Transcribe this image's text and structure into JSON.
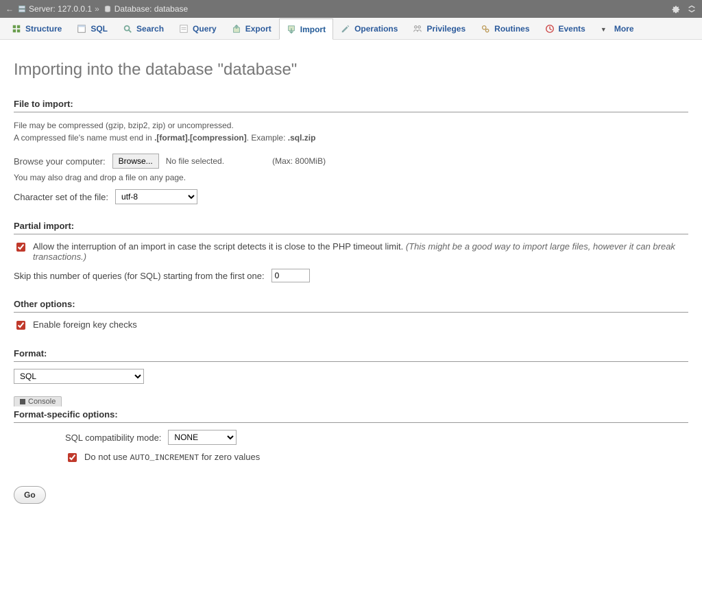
{
  "breadcrumb": {
    "back_arrow": "←",
    "server_label": "Server:",
    "server_value": "127.0.0.1",
    "db_label": "Database:",
    "db_value": "database"
  },
  "tabs": [
    {
      "label": "Structure",
      "icon": "structure"
    },
    {
      "label": "SQL",
      "icon": "sql"
    },
    {
      "label": "Search",
      "icon": "search"
    },
    {
      "label": "Query",
      "icon": "query"
    },
    {
      "label": "Export",
      "icon": "export"
    },
    {
      "label": "Import",
      "icon": "import",
      "active": true
    },
    {
      "label": "Operations",
      "icon": "operations"
    },
    {
      "label": "Privileges",
      "icon": "privileges"
    },
    {
      "label": "Routines",
      "icon": "routines"
    },
    {
      "label": "Events",
      "icon": "events"
    },
    {
      "label": "More",
      "icon": "more"
    }
  ],
  "page_title": "Importing into the database \"database\"",
  "sections": {
    "file_to_import": "File to import:",
    "partial_import": "Partial import:",
    "other_options": "Other options:",
    "format": "Format:",
    "format_specific": "Format-specific options:"
  },
  "file": {
    "compressed_note1": "File may be compressed (gzip, bzip2, zip) or uncompressed.",
    "compressed_note2a": "A compressed file's name must end in ",
    "compressed_note2b": ".[format].[compression]",
    "compressed_note2c": ". Example: ",
    "compressed_note2d": ".sql.zip",
    "browse_label": "Browse your computer:",
    "browse_button": "Browse...",
    "no_file": "No file selected.",
    "max": "(Max: 800MiB)",
    "drag_note": "You may also drag and drop a file on any page.",
    "charset_label": "Character set of the file:",
    "charset_value": "utf-8"
  },
  "partial": {
    "allow_interrupt_label": "Allow the interruption of an import in case the script detects it is close to the PHP timeout limit.",
    "allow_interrupt_hint": "(This might be a good way to import large files, however it can break transactions.)",
    "allow_interrupt_checked": true,
    "skip_label": "Skip this number of queries (for SQL) starting from the first one:",
    "skip_value": 0
  },
  "other": {
    "fk_label": "Enable foreign key checks",
    "fk_checked": true
  },
  "format_select": {
    "value": "SQL"
  },
  "console_label": "Console",
  "format_specific": {
    "compat_label": "SQL compatibility mode:",
    "compat_value": "NONE",
    "auto_inc_label_a": "Do not use ",
    "auto_inc_code": "AUTO_INCREMENT",
    "auto_inc_label_b": " for zero values",
    "auto_inc_checked": true
  },
  "go_button": "Go"
}
